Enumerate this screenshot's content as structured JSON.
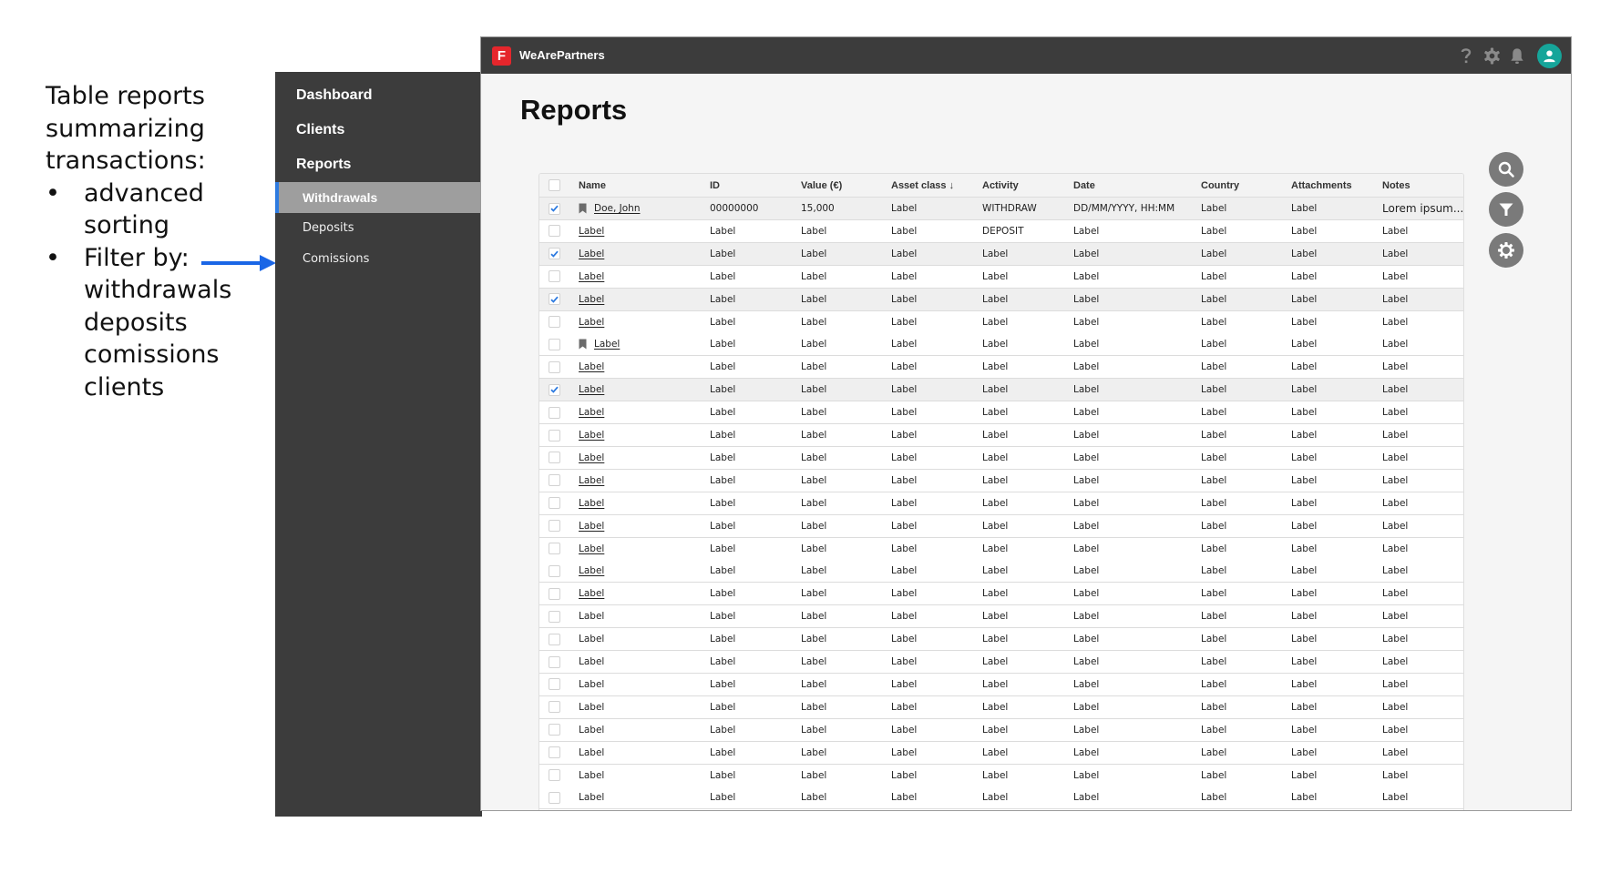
{
  "annotation": {
    "intro_lines": [
      "Table reports",
      "summarizing",
      "transactions:"
    ],
    "bullets": [
      {
        "lines": [
          "advanced",
          "sorting"
        ]
      },
      {
        "lines": [
          "Filter by:",
          "withdrawals",
          "deposits",
          "comissions",
          "clients"
        ]
      }
    ],
    "arrow_color": "#1a66e6"
  },
  "sidebar": {
    "main_items": [
      {
        "label": "Dashboard"
      },
      {
        "label": "Clients"
      },
      {
        "label": "Reports"
      }
    ],
    "sub_items": [
      {
        "label": "Withdrawals",
        "active": true
      },
      {
        "label": "Deposits",
        "active": false
      },
      {
        "label": "Comissions",
        "active": false
      }
    ]
  },
  "app": {
    "brand": "WeArePartners",
    "logo_letter": "F",
    "brand_color": "#e5262c",
    "header_icons": [
      "help-icon",
      "settings-icon",
      "notifications-icon",
      "user-avatar-icon"
    ],
    "avatar_color": "#16a59a"
  },
  "page": {
    "title": "Reports"
  },
  "table": {
    "columns": [
      "Name",
      "ID",
      "Value (€)",
      "Asset class ↓",
      "Activity",
      "Date",
      "Country",
      "Attachments",
      "Notes"
    ],
    "sorted_column": "Asset class",
    "sort_direction": "descending",
    "rows": [
      {
        "checked": true,
        "bookmarked": true,
        "link": true,
        "cells": [
          "Doe, John",
          "00000000",
          "15,000",
          "Label",
          "WITHDRAW",
          "DD/MM/YYYY, HH:MM",
          "Label",
          "Label",
          "Lorem ipsum..."
        ]
      },
      {
        "checked": false,
        "bookmarked": false,
        "link": true,
        "cells": [
          "Label",
          "Label",
          "Label",
          "Label",
          "DEPOSIT",
          "Label",
          "Label",
          "Label",
          "Label"
        ]
      },
      {
        "checked": true,
        "bookmarked": false,
        "link": true,
        "cells": [
          "Label",
          "Label",
          "Label",
          "Label",
          "Label",
          "Label",
          "Label",
          "Label",
          "Label"
        ]
      },
      {
        "checked": false,
        "bookmarked": false,
        "link": true,
        "cells": [
          "Label",
          "Label",
          "Label",
          "Label",
          "Label",
          "Label",
          "Label",
          "Label",
          "Label"
        ]
      },
      {
        "checked": true,
        "bookmarked": false,
        "link": true,
        "cells": [
          "Label",
          "Label",
          "Label",
          "Label",
          "Label",
          "Label",
          "Label",
          "Label",
          "Label"
        ]
      },
      {
        "checked": false,
        "bookmarked": false,
        "link": true,
        "cells": [
          "Label",
          "Label",
          "Label",
          "Label",
          "Label",
          "Label",
          "Label",
          "Label",
          "Label"
        ]
      },
      {
        "checked": false,
        "bookmarked": true,
        "link": true,
        "cells": [
          "Label",
          "Label",
          "Label",
          "Label",
          "Label",
          "Label",
          "Label",
          "Label",
          "Label"
        ]
      },
      {
        "checked": false,
        "bookmarked": false,
        "link": true,
        "cells": [
          "Label",
          "Label",
          "Label",
          "Label",
          "Label",
          "Label",
          "Label",
          "Label",
          "Label"
        ]
      },
      {
        "checked": true,
        "bookmarked": false,
        "link": true,
        "cells": [
          "Label",
          "Label",
          "Label",
          "Label",
          "Label",
          "Label",
          "Label",
          "Label",
          "Label"
        ]
      },
      {
        "checked": false,
        "bookmarked": false,
        "link": true,
        "cells": [
          "Label",
          "Label",
          "Label",
          "Label",
          "Label",
          "Label",
          "Label",
          "Label",
          "Label"
        ]
      },
      {
        "checked": false,
        "bookmarked": false,
        "link": true,
        "cells": [
          "Label",
          "Label",
          "Label",
          "Label",
          "Label",
          "Label",
          "Label",
          "Label",
          "Label"
        ]
      },
      {
        "checked": false,
        "bookmarked": false,
        "link": true,
        "cells": [
          "Label",
          "Label",
          "Label",
          "Label",
          "Label",
          "Label",
          "Label",
          "Label",
          "Label"
        ]
      },
      {
        "checked": false,
        "bookmarked": false,
        "link": true,
        "cells": [
          "Label",
          "Label",
          "Label",
          "Label",
          "Label",
          "Label",
          "Label",
          "Label",
          "Label"
        ]
      },
      {
        "checked": false,
        "bookmarked": false,
        "link": true,
        "cells": [
          "Label",
          "Label",
          "Label",
          "Label",
          "Label",
          "Label",
          "Label",
          "Label",
          "Label"
        ]
      },
      {
        "checked": false,
        "bookmarked": false,
        "link": true,
        "cells": [
          "Label",
          "Label",
          "Label",
          "Label",
          "Label",
          "Label",
          "Label",
          "Label",
          "Label"
        ]
      },
      {
        "checked": false,
        "bookmarked": false,
        "link": true,
        "cells": [
          "Label",
          "Label",
          "Label",
          "Label",
          "Label",
          "Label",
          "Label",
          "Label",
          "Label"
        ]
      },
      {
        "checked": false,
        "bookmarked": false,
        "link": true,
        "cells": [
          "Label",
          "Label",
          "Label",
          "Label",
          "Label",
          "Label",
          "Label",
          "Label",
          "Label"
        ]
      },
      {
        "checked": false,
        "bookmarked": false,
        "link": true,
        "cells": [
          "Label",
          "Label",
          "Label",
          "Label",
          "Label",
          "Label",
          "Label",
          "Label",
          "Label"
        ]
      },
      {
        "checked": false,
        "bookmarked": false,
        "link": false,
        "cells": [
          "Label",
          "Label",
          "Label",
          "Label",
          "Label",
          "Label",
          "Label",
          "Label",
          "Label"
        ]
      },
      {
        "checked": false,
        "bookmarked": false,
        "link": false,
        "cells": [
          "Label",
          "Label",
          "Label",
          "Label",
          "Label",
          "Label",
          "Label",
          "Label",
          "Label"
        ]
      },
      {
        "checked": false,
        "bookmarked": false,
        "link": false,
        "cells": [
          "Label",
          "Label",
          "Label",
          "Label",
          "Label",
          "Label",
          "Label",
          "Label",
          "Label"
        ]
      },
      {
        "checked": false,
        "bookmarked": false,
        "link": false,
        "cells": [
          "Label",
          "Label",
          "Label",
          "Label",
          "Label",
          "Label",
          "Label",
          "Label",
          "Label"
        ]
      },
      {
        "checked": false,
        "bookmarked": false,
        "link": false,
        "cells": [
          "Label",
          "Label",
          "Label",
          "Label",
          "Label",
          "Label",
          "Label",
          "Label",
          "Label"
        ]
      },
      {
        "checked": false,
        "bookmarked": false,
        "link": false,
        "cells": [
          "Label",
          "Label",
          "Label",
          "Label",
          "Label",
          "Label",
          "Label",
          "Label",
          "Label"
        ]
      },
      {
        "checked": false,
        "bookmarked": false,
        "link": false,
        "cells": [
          "Label",
          "Label",
          "Label",
          "Label",
          "Label",
          "Label",
          "Label",
          "Label",
          "Label"
        ]
      },
      {
        "checked": false,
        "bookmarked": false,
        "link": false,
        "cells": [
          "Label",
          "Label",
          "Label",
          "Label",
          "Label",
          "Label",
          "Label",
          "Label",
          "Label"
        ]
      },
      {
        "checked": false,
        "bookmarked": false,
        "link": false,
        "cells": [
          "Label",
          "Label",
          "Label",
          "Label",
          "Label",
          "Label",
          "Label",
          "Label",
          "Label"
        ]
      }
    ]
  },
  "actions": [
    {
      "name": "search-button",
      "icon": "search-icon"
    },
    {
      "name": "filter-button",
      "icon": "filter-icon"
    },
    {
      "name": "settings-button",
      "icon": "gear-icon"
    }
  ]
}
